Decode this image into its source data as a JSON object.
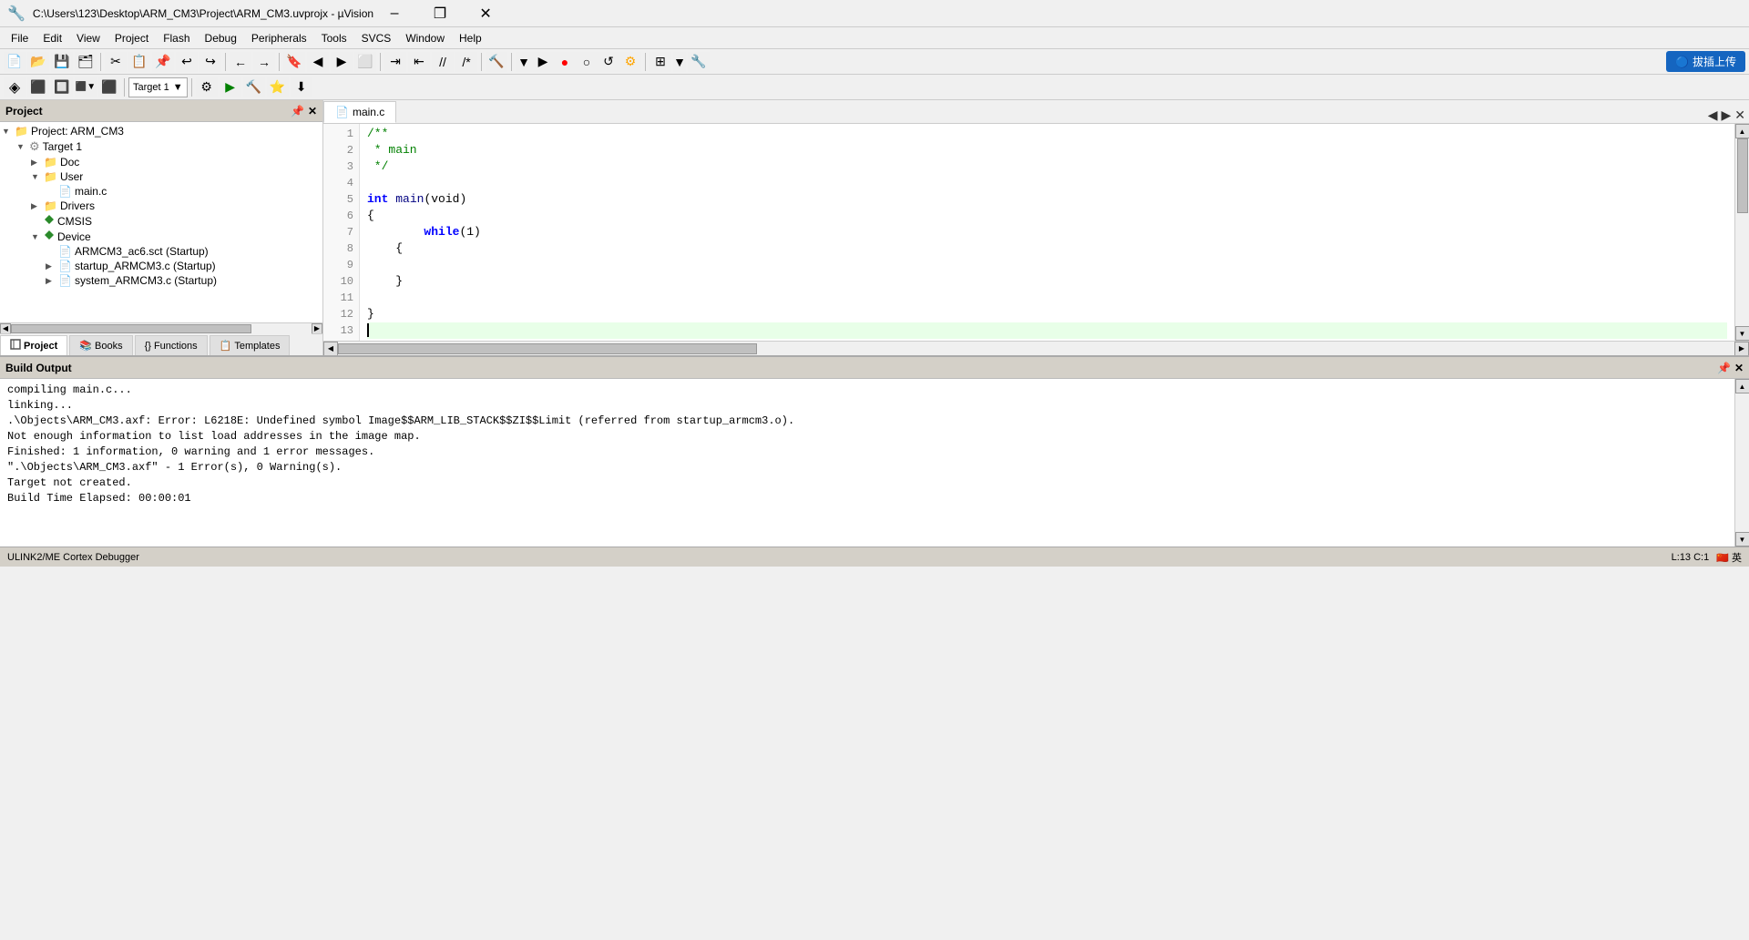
{
  "titlebar": {
    "title": "C:\\Users\\123\\Desktop\\ARM_CM3\\Project\\ARM_CM3.uvprojx - µVision",
    "minimize": "–",
    "maximize": "❐",
    "close": "✕"
  },
  "menubar": {
    "items": [
      "File",
      "Edit",
      "View",
      "Project",
      "Flash",
      "Debug",
      "Peripherals",
      "Tools",
      "SVCS",
      "Window",
      "Help"
    ]
  },
  "toolbar1": {
    "target_label": "Target 1"
  },
  "upload_btn": {
    "label": "拔插上传",
    "icon": "🔵"
  },
  "project_panel": {
    "title": "Project",
    "tree": [
      {
        "level": 0,
        "expand": "▼",
        "icon": "🗂",
        "icon_type": "folder",
        "label": "Project: ARM_CM3"
      },
      {
        "level": 1,
        "expand": "▼",
        "icon": "⚙",
        "icon_type": "gear",
        "label": "Target 1"
      },
      {
        "level": 2,
        "expand": "▶",
        "icon": "📁",
        "icon_type": "folder",
        "label": "Doc"
      },
      {
        "level": 2,
        "expand": "▼",
        "icon": "📁",
        "icon_type": "folder",
        "label": "User"
      },
      {
        "level": 3,
        "expand": "",
        "icon": "📄",
        "icon_type": "file",
        "label": "main.c"
      },
      {
        "level": 2,
        "expand": "▶",
        "icon": "📁",
        "icon_type": "folder",
        "label": "Drivers"
      },
      {
        "level": 2,
        "expand": "",
        "icon": "◆",
        "icon_type": "diamond",
        "label": "CMSIS"
      },
      {
        "level": 2,
        "expand": "▼",
        "icon": "◆",
        "icon_type": "diamond",
        "label": "Device"
      },
      {
        "level": 3,
        "expand": "",
        "icon": "📄",
        "icon_type": "file",
        "label": "ARMCM3_ac6.sct (Startup)"
      },
      {
        "level": 3,
        "expand": "▶",
        "icon": "📄",
        "icon_type": "file",
        "label": "startup_ARMCM3.c (Startup)"
      },
      {
        "level": 3,
        "expand": "▶",
        "icon": "📄",
        "icon_type": "file",
        "label": "system_ARMCM3.c (Startup)"
      }
    ],
    "tabs": [
      {
        "label": "Project",
        "icon": "🗂",
        "active": true
      },
      {
        "label": "Books",
        "icon": "📚",
        "active": false
      },
      {
        "label": "Functions",
        "icon": "{}",
        "active": false
      },
      {
        "label": "Templates",
        "icon": "📋",
        "active": false
      }
    ]
  },
  "editor": {
    "tab": "main.c",
    "lines": [
      {
        "num": 1,
        "content": "/**",
        "type": "comment",
        "highlighted": false
      },
      {
        "num": 2,
        "content": " * main",
        "type": "comment",
        "highlighted": false
      },
      {
        "num": 3,
        "content": " */",
        "type": "comment",
        "highlighted": false
      },
      {
        "num": 4,
        "content": "",
        "type": "normal",
        "highlighted": false
      },
      {
        "num": 5,
        "content": "int main(void)",
        "type": "code",
        "highlighted": false
      },
      {
        "num": 6,
        "content": "{",
        "type": "code",
        "highlighted": false
      },
      {
        "num": 7,
        "content": "\twhile(1)",
        "type": "code",
        "highlighted": false
      },
      {
        "num": 8,
        "content": "\t{",
        "type": "code",
        "highlighted": false
      },
      {
        "num": 9,
        "content": "",
        "type": "normal",
        "highlighted": false
      },
      {
        "num": 10,
        "content": "\t}",
        "type": "code",
        "highlighted": false
      },
      {
        "num": 11,
        "content": "",
        "type": "normal",
        "highlighted": false
      },
      {
        "num": 12,
        "content": "}",
        "type": "code",
        "highlighted": false
      },
      {
        "num": 13,
        "content": "",
        "type": "cursor",
        "highlighted": true
      }
    ]
  },
  "build_output": {
    "title": "Build Output",
    "lines": [
      "compiling main.c...",
      "linking...",
      ".\\Objects\\ARM_CM3.axf: Error: L6218E: Undefined symbol Image$$ARM_LIB_STACK$$ZI$$Limit (referred from startup_armcm3.o).",
      "Not enough information to list load addresses in the image map.",
      "Finished: 1 information, 0 warning and 1 error messages.",
      "\".\\Objects\\ARM_CM3.axf\" - 1 Error(s), 0 Warning(s).",
      "Target not created.",
      "Build Time Elapsed:  00:00:01"
    ]
  },
  "statusbar": {
    "debugger": "ULINK2/ME Cortex Debugger",
    "cursor": "L:13 C:1"
  }
}
